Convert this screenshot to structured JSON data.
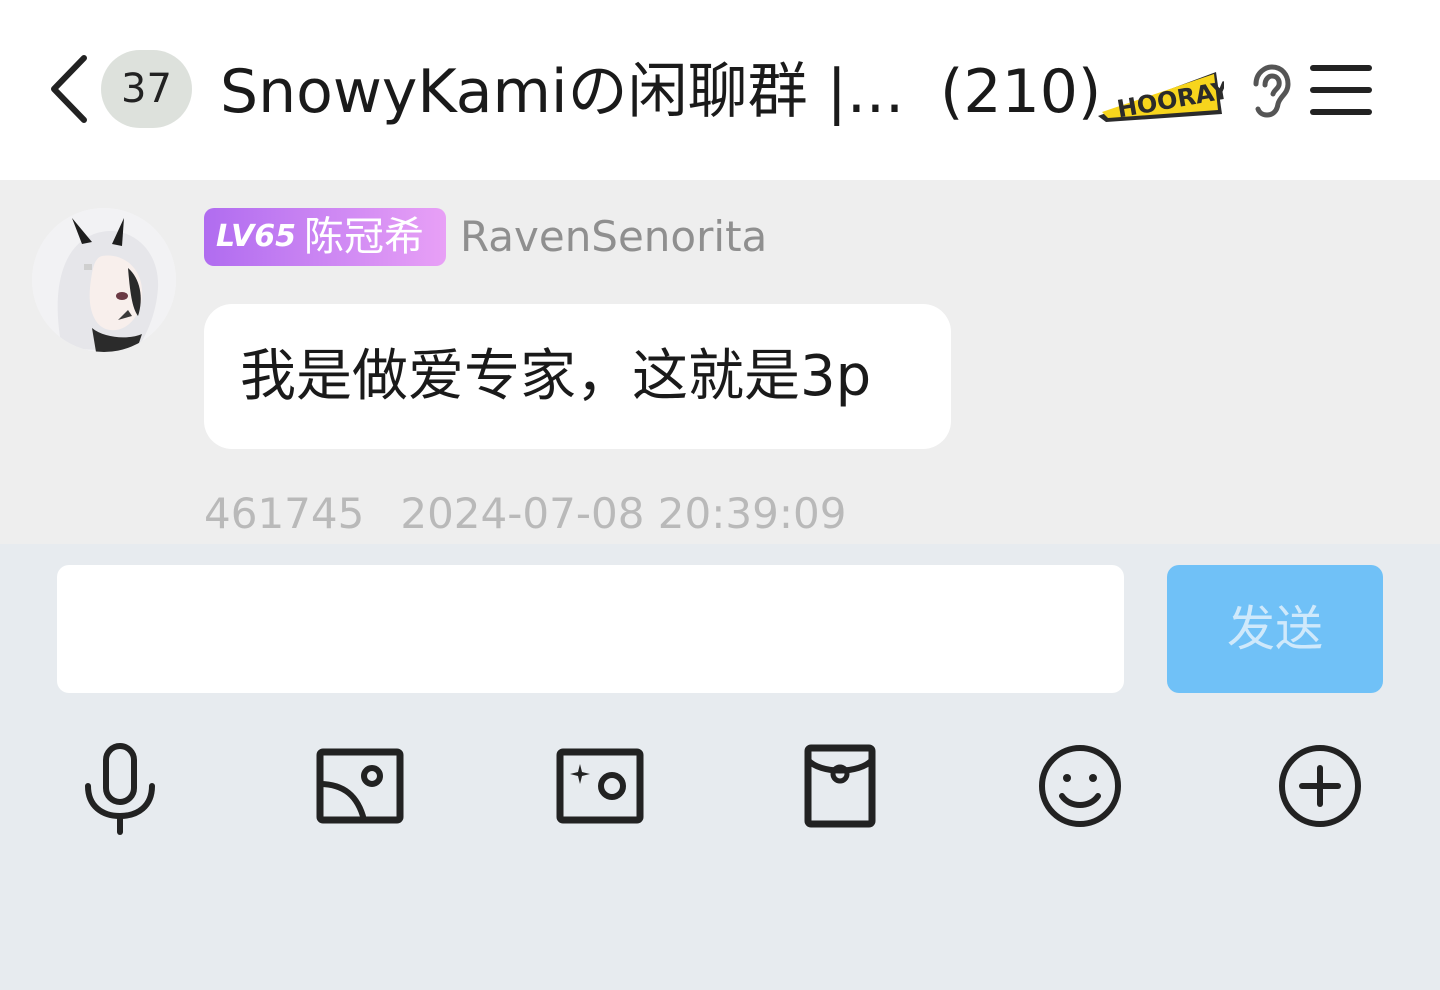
{
  "header": {
    "unread_count": "37",
    "title": "SnowyKamiの闲聊群 |...",
    "member_count": "(210)",
    "logo_text": "HOORAY",
    "icons": {
      "back": "chevron-left-icon",
      "ear": "ear-icon",
      "menu": "menu-icon"
    }
  },
  "message": {
    "level": "LV65",
    "nickname": "陈冠希",
    "username": "RavenSenorita",
    "text": "我是做爱专家，这就是3p",
    "message_id": "461745",
    "timestamp": "2024-07-08 20:39:09"
  },
  "composer": {
    "input_value": "",
    "input_placeholder": "",
    "send_label": "发送",
    "tools": [
      "microphone-icon",
      "image-icon",
      "camera-icon",
      "red-packet-icon",
      "emoji-icon",
      "plus-icon"
    ]
  },
  "colors": {
    "header_bg": "#ffffff",
    "chat_bg": "#eeeeee",
    "composer_bg": "#e7ebef",
    "send_button": "#70c1f7",
    "level_badge_start": "#b06cf0",
    "level_badge_end": "#e8a0f6"
  }
}
